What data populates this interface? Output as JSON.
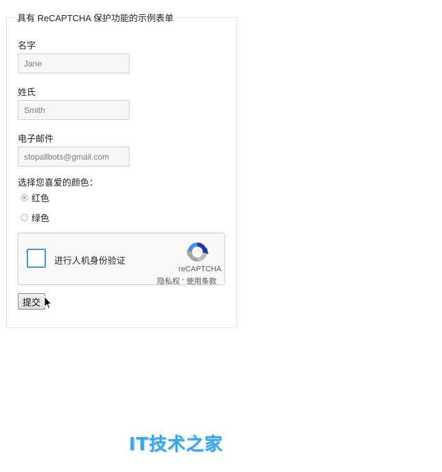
{
  "form": {
    "legend": "具有 ReCAPTCHA 保护功能的示例表单",
    "first_name": {
      "label": "名字",
      "placeholder": "Jane"
    },
    "last_name": {
      "label": "姓氏",
      "placeholder": "Smith"
    },
    "email": {
      "label": "电子邮件",
      "placeholder": "stopallbots@gmail.com"
    },
    "color_question": "选择您喜爱的颜色：",
    "color_options": [
      {
        "label": "红色",
        "checked": true
      },
      {
        "label": "绿色",
        "checked": false
      }
    ],
    "submit_label": "提交"
  },
  "recaptcha": {
    "checkbox_label": "进行人机身份验证",
    "brand": "reCAPTCHA",
    "privacy_link": "隐私权",
    "separator": "-",
    "terms_link": "使用条款",
    "logo_icon": "recaptcha-logo-icon"
  },
  "watermark": {
    "text": "IT技术之家",
    "color": "#3aa6e8"
  }
}
